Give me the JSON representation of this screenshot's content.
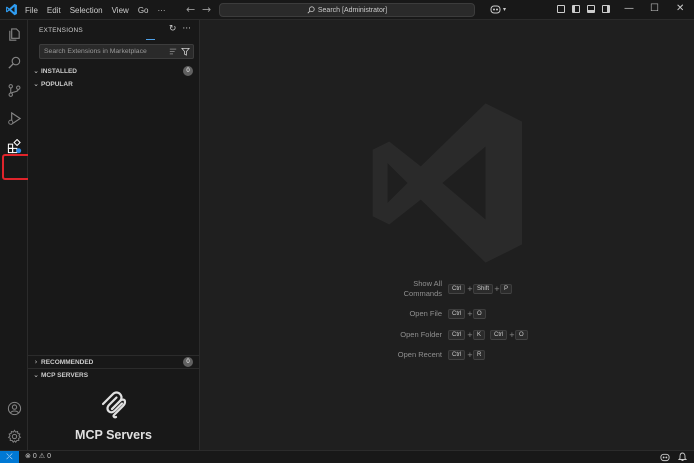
{
  "menu": [
    "File",
    "Edit",
    "Selection",
    "View",
    "Go",
    "···"
  ],
  "search": {
    "text": "Search [Administrator]"
  },
  "sidebar": {
    "title": "EXTENSIONS",
    "search_placeholder": "Search Extensions in Marketplace",
    "sections": {
      "installed": {
        "label": "INSTALLED",
        "count": "0"
      },
      "popular": {
        "label": "POPULAR"
      },
      "recommended": {
        "label": "RECOMMENDED",
        "count": "0"
      },
      "mcp": {
        "label": "MCP SERVERS"
      }
    },
    "mcp_banner_title": "MCP Servers"
  },
  "shortcuts": [
    {
      "label_line1": "Show All",
      "label_line2": "Commands",
      "keys": [
        "Ctrl",
        "+",
        "Shift",
        "+",
        "P"
      ]
    },
    {
      "label": "Open File",
      "keys": [
        "Ctrl",
        "+",
        "O"
      ]
    },
    {
      "label": "Open Folder",
      "keys": [
        "Ctrl",
        "+",
        "K",
        "Ctrl",
        "+",
        "O"
      ]
    },
    {
      "label": "Open Recent",
      "keys": [
        "Ctrl",
        "+",
        "R"
      ]
    }
  ],
  "status": {
    "errors": "0",
    "warnings": "0"
  },
  "colors": {
    "accent": "#0078d4",
    "highlight_box": "#e0242b",
    "tab_underline": "#4fa1e8"
  }
}
